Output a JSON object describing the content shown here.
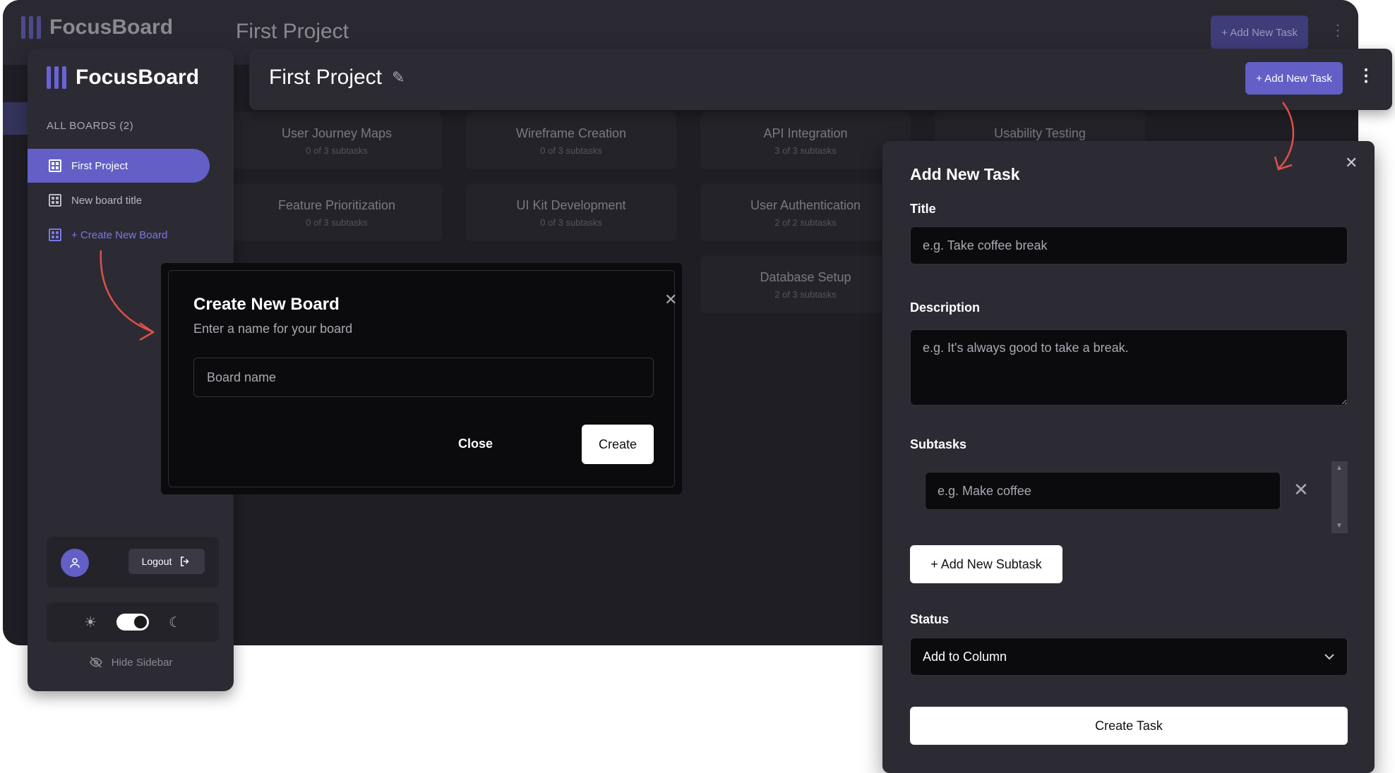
{
  "background_app": {
    "logo": "FocusBoard",
    "title": "First Project",
    "add_button": "+ Add New Task",
    "cards": [
      {
        "title": "User Journey Maps",
        "subtasks": "0 of 3 subtasks"
      },
      {
        "title": "Wireframe Creation",
        "subtasks": "0 of 3 subtasks"
      },
      {
        "title": "API Integration",
        "subtasks": "3 of 3 subtasks"
      },
      {
        "title": "Usability Testing",
        "subtasks": ""
      },
      {
        "title": "Feature Prioritization",
        "subtasks": "0 of 3 subtasks"
      },
      {
        "title": "UI Kit Development",
        "subtasks": "0 of 3 subtasks"
      },
      {
        "title": "User Authentication",
        "subtasks": "2 of 2 subtasks"
      },
      {
        "title": "Database Setup",
        "subtasks": "2 of 3 subtasks"
      }
    ]
  },
  "sidebar": {
    "logo": "FocusBoard",
    "heading": "ALL BOARDS (2)",
    "items": [
      {
        "label": "First Project"
      },
      {
        "label": "New board title"
      },
      {
        "label": "+ Create New Board"
      }
    ],
    "logout_label": "Logout",
    "hide_label": "Hide Sidebar"
  },
  "header": {
    "title": "First Project",
    "add_button": "+ Add New Task"
  },
  "create_board_modal": {
    "title": "Create New Board",
    "subtitle": "Enter a name for your board",
    "input_placeholder": "Board name",
    "close_label": "Close",
    "create_label": "Create"
  },
  "add_task_modal": {
    "title": "Add New Task",
    "title_label": "Title",
    "title_placeholder": "e.g. Take coffee break",
    "description_label": "Description",
    "description_placeholder": "e.g. It's always good to take a break.",
    "subtasks_label": "Subtasks",
    "subtask_placeholder": "e.g. Make coffee",
    "add_subtask_label": "+ Add New Subtask",
    "status_label": "Status",
    "status_value": "Add to Column",
    "create_label": "Create Task"
  },
  "colors": {
    "accent": "#635fc7",
    "annotation_arrow": "#e0504a"
  }
}
